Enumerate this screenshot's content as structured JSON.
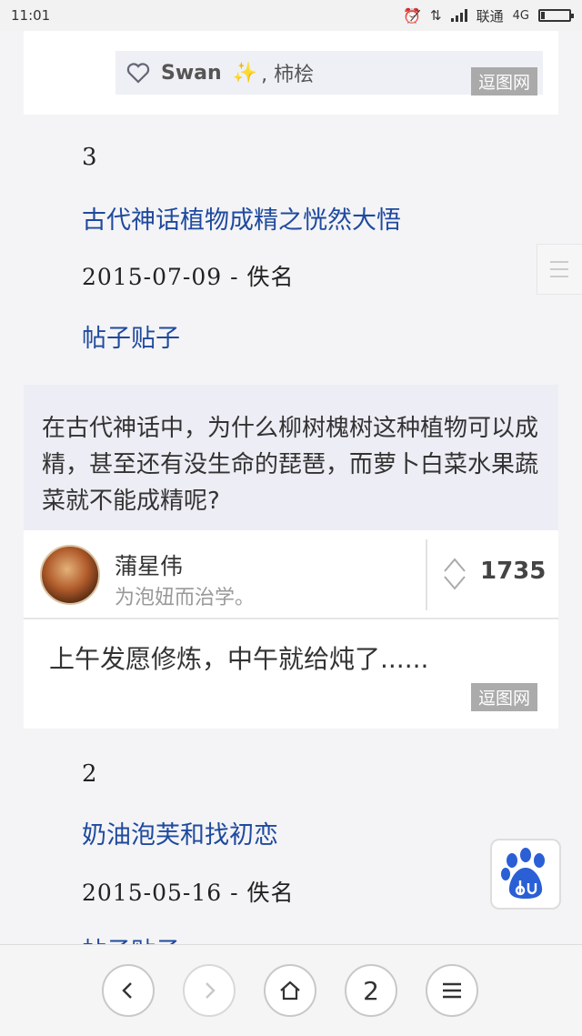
{
  "status_bar": {
    "time": "11:01",
    "carrier": "联通",
    "network": "4G"
  },
  "card_top": {
    "name": "Swan",
    "sparkle": "✨",
    "suffix": ", 柿桧",
    "watermark": "逗图网"
  },
  "entries": [
    {
      "number": "3",
      "title": "古代神话植物成精之恍然大悟",
      "date_author": "2015-07-09 - 佚名",
      "tag": "帖子贴子"
    },
    {
      "number": "2",
      "title": "奶油泡芙和找初恋",
      "date_author": "2015-05-16 - 佚名",
      "tag": "帖子贴子"
    }
  ],
  "qa_card": {
    "question": "在古代神话中，为什么柳树槐树这种植物可以成精，甚至还有没生命的琵琶，而萝卜白菜水果蔬菜就不能成精呢?",
    "author_name": "蒲星伟",
    "author_signature": "为泡妞而治学。",
    "votes": "1735",
    "answer": "上午发愿修炼，中午就给炖了......",
    "watermark": "逗图网"
  },
  "bottom_nav": {
    "tab_count": "2"
  },
  "icons": {
    "heart": "heart-icon",
    "vote": "updown-arrow-icon",
    "baidu": "baidu-paw-icon",
    "back": "chevron-left-icon",
    "forward": "chevron-right-icon",
    "home": "home-icon",
    "menu": "menu-icon"
  }
}
